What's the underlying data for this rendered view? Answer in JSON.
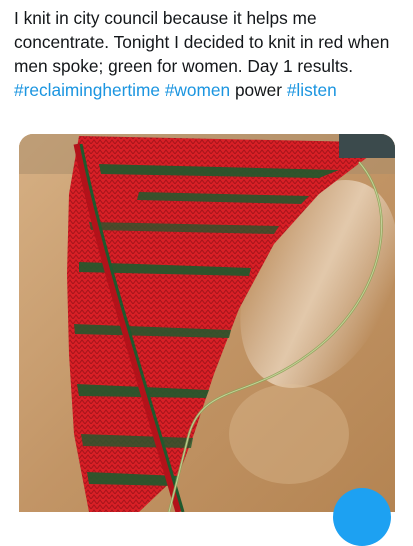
{
  "tweet": {
    "text_plain": "I knit in city council because it helps me concentrate. Tonight I decided to knit in red when men spoke; green for women. Day 1 results. ",
    "hashtags": [
      "#reclaiminghertime",
      "#women"
    ],
    "text_after_hashtags": " power ",
    "hashtag_last": "#listen"
  },
  "colors": {
    "link": "#1b95e0",
    "text": "#14171a",
    "knit_red": "#d81f26",
    "knit_green": "#1f5a2e",
    "table_wood": "#c59a68",
    "fab": "#1da1f2"
  },
  "icons": {
    "fab": "compose-icon"
  }
}
